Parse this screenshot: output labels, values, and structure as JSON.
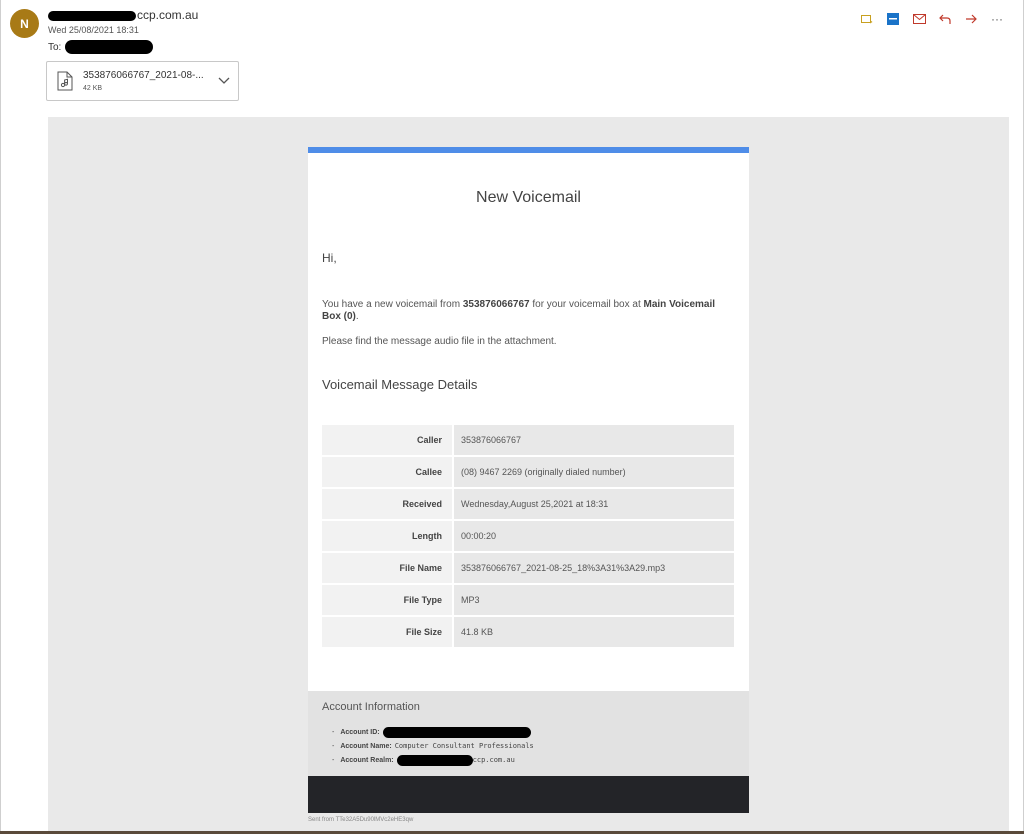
{
  "header": {
    "avatar_initial": "N",
    "sender_domain": "ccp.com.au",
    "date": "Wed 25/08/2021 18:31",
    "to_label": "To:"
  },
  "toolbar": {
    "icons": [
      "flag-icon",
      "app-icon",
      "mail-icon",
      "reply-icon",
      "forward-icon",
      "more-icon"
    ],
    "more_label": "···"
  },
  "attachment": {
    "name": "353876066767_2021-08-...",
    "size": "42 KB"
  },
  "email": {
    "title": "New Voicemail",
    "greeting": "Hi,",
    "para1_prefix": "You have a new voicemail from ",
    "para1_caller": "353876066767",
    "para1_mid": " for your voicemail box at ",
    "para1_box": "Main Voicemail Box (0)",
    "para1_suffix": ".",
    "para2": "Please find the message audio file in the attachment.",
    "section_title": "Voicemail Message Details",
    "details": [
      {
        "label": "Caller",
        "value": "353876066767"
      },
      {
        "label": "Callee",
        "value": "(08) 9467 2269 (originally dialed number)"
      },
      {
        "label": "Received",
        "value": "Wednesday,August 25,2021 at 18:31"
      },
      {
        "label": "Length",
        "value": "00:00:20"
      },
      {
        "label": "File Name",
        "value": "353876066767_2021-08-25_18%3A31%3A29.mp3"
      },
      {
        "label": "File Type",
        "value": "MP3"
      },
      {
        "label": "File Size",
        "value": "41.8 KB"
      }
    ]
  },
  "account": {
    "title": "Account Information",
    "id_label": "Account ID:",
    "name_label": "Account Name:",
    "name_value": "Computer Consultant Professionals",
    "realm_label": "Account Realm:",
    "realm_suffix": "ccp.com.au",
    "dash": "-"
  },
  "footer": {
    "sent_from": "Sent from TTe32A5Du90lMVc2eHE3qw"
  },
  "colors": {
    "accent_bar": "#4f8de8",
    "avatar": "#a87a16",
    "footer_dark": "#232428"
  }
}
